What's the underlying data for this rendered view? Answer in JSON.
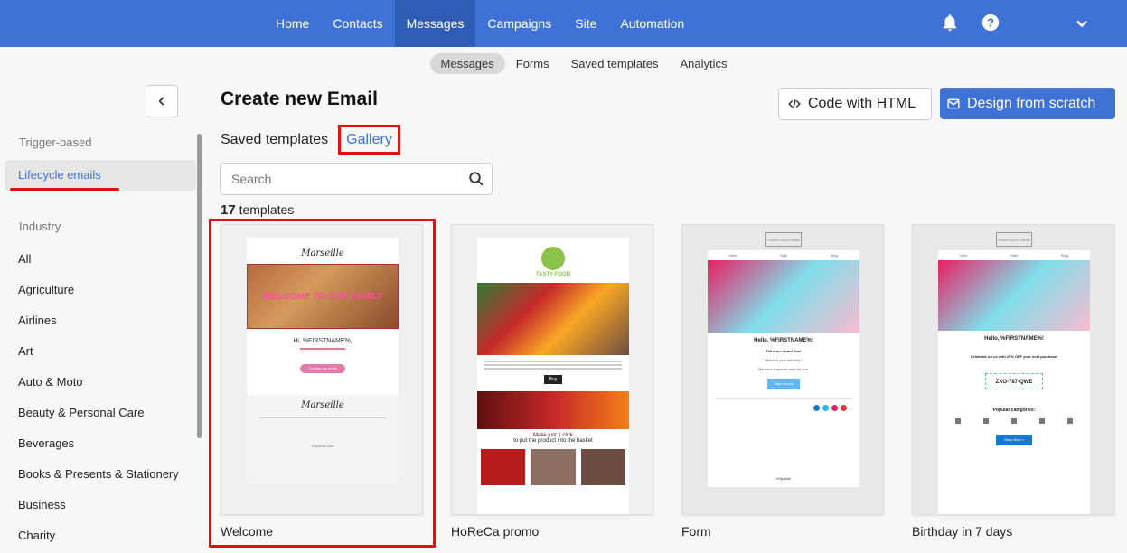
{
  "nav": {
    "items": [
      "Home",
      "Contacts",
      "Messages",
      "Campaigns",
      "Site",
      "Automation"
    ],
    "active": "Messages"
  },
  "subnav": {
    "items": [
      "Messages",
      "Forms",
      "Saved templates",
      "Analytics"
    ],
    "active": "Messages"
  },
  "sidebar": {
    "group1": "Trigger-based",
    "active_item": "Lifecycle emails",
    "group2": "Industry",
    "categories": [
      "All",
      "Agriculture",
      "Airlines",
      "Art",
      "Auto & Moto",
      "Beauty & Personal Care",
      "Beverages",
      "Books & Presents & Stationery",
      "Business",
      "Charity"
    ]
  },
  "main": {
    "title": "Create new Email",
    "code_html_label": "Code with HTML",
    "design_label": "Design from scratch",
    "tab_saved": "Saved templates",
    "tab_gallery": "Gallery",
    "search_placeholder": "Search",
    "count_number": "17",
    "count_label": "templates"
  },
  "templates": [
    {
      "name": "Welcome",
      "brand": "Marseille",
      "banner": "WELCOME TO OUR FAMILY",
      "greeting": "Hi, %FIRSTNAME%,",
      "button": "Confirm my email",
      "footer_brand": "Marseille",
      "footer_logo": "eSputnik.com"
    },
    {
      "name": "HoReCa promo",
      "brand": "TASTY FOOD",
      "button": "Buy",
      "promo_line1": "Make just 1 click",
      "promo_line2": "to put the product into the basket"
    },
    {
      "name": "Form",
      "logo": "YOUR LOGO HERE",
      "nav": [
        "New",
        "Sale",
        "Blog"
      ],
      "hello": "Hello, %FIRSTNAME%!",
      "tell": "Tell more about You!",
      "question": "When is your birthday?",
      "offer": "We have a special treat for you.",
      "button": "Take survey",
      "footer_logo": "eSputnik"
    },
    {
      "name": "Birthday in 7 days",
      "logo": "YOUR LOGO HERE",
      "nav": [
        "New",
        "Sale",
        "Blog"
      ],
      "hello": "Hello, %FIRSTNAME%!",
      "celebrate": "Celebrate on us with 20% OFF your next purchase!",
      "code": "ZXO-787-QWE",
      "popular": "Popular categories:",
      "button": "Shop Now »"
    }
  ],
  "colors": {
    "nav_bg": "#3f72d6",
    "accent": "#3f72d6",
    "highlight": "#e01010"
  },
  "icons": [
    "bell-icon",
    "help-icon",
    "chevron-down-icon",
    "chevron-left-icon",
    "code-icon",
    "mail-icon",
    "search-icon"
  ]
}
